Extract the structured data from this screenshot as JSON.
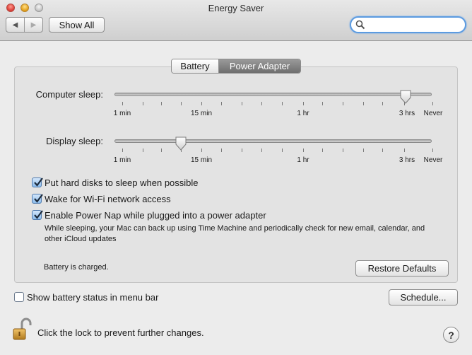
{
  "window": {
    "title": "Energy Saver"
  },
  "toolbar": {
    "back_icon": "triangle-left",
    "forward_icon": "triangle-right",
    "show_all_label": "Show All",
    "search_value": ""
  },
  "tabs": [
    {
      "label": "Battery",
      "selected": false
    },
    {
      "label": "Power Adapter",
      "selected": true
    }
  ],
  "sliders": [
    {
      "label": "Computer sleep:",
      "value": "3 hrs",
      "tick_labels": [
        "1 min",
        "15 min",
        "1 hr",
        "3 hrs",
        "Never"
      ]
    },
    {
      "label": "Display sleep:",
      "value": "10 min",
      "tick_labels": [
        "1 min",
        "15 min",
        "1 hr",
        "3 hrs",
        "Never"
      ]
    }
  ],
  "options": [
    {
      "label": "Put hard disks to sleep when possible",
      "checked": true
    },
    {
      "label": "Wake for Wi-Fi network access",
      "checked": true
    },
    {
      "label": "Enable Power Nap while plugged into a power adapter",
      "checked": true
    }
  ],
  "power_nap_description": "While sleeping, your Mac can back up using Time Machine and periodically check for new email, calendar, and other iCloud updates",
  "battery_status": "Battery is charged.",
  "restore_defaults_label": "Restore Defaults",
  "menu_bar_option": {
    "label": "Show battery status in menu bar",
    "checked": false
  },
  "schedule_label": "Schedule...",
  "lock_text": "Click the lock to prevent further changes.",
  "help_label": "?",
  "colors": {
    "accent": "#5c9be0",
    "selected_tab": "#7f7f7f"
  }
}
